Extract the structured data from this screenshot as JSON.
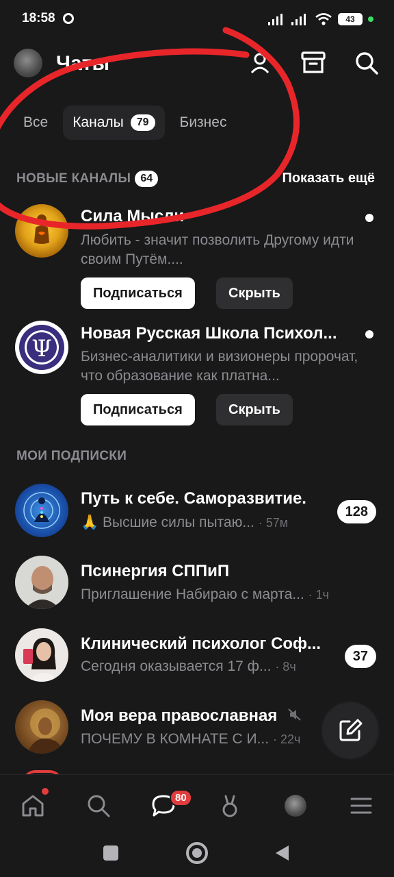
{
  "status_bar": {
    "time": "18:58",
    "battery": "43"
  },
  "header": {
    "title": "Чаты"
  },
  "tabs": [
    {
      "label": "Все"
    },
    {
      "label": "Каналы",
      "badge": "79"
    },
    {
      "label": "Бизнес"
    }
  ],
  "new_channels": {
    "title": "НОВЫЕ КАНАЛЫ",
    "badge": "64",
    "show_more": "Показать ещё",
    "items": [
      {
        "title": "Сила Мысли",
        "description": "Любить - значит позволить Другому идти своим Путём....",
        "subscribe": "Подписаться",
        "hide": "Скрыть"
      },
      {
        "title": "Новая Русская Школа Психол...",
        "description": "Бизнес-аналитики и визионеры пророчат, что образование как платна...",
        "subscribe": "Подписаться",
        "hide": "Скрыть"
      }
    ]
  },
  "subscriptions": {
    "title": "МОИ ПОДПИСКИ",
    "items": [
      {
        "title": "Путь к себе. Саморазвитие.",
        "preview": "🙏 Высшие силы пытаю...",
        "time": "· 57м",
        "count": "128"
      },
      {
        "title": "Псинергия СППиП",
        "preview": "Приглашение  Набираю с марта...",
        "time": "· 1ч",
        "count": ""
      },
      {
        "title": "Клинический психолог Соф...",
        "preview": "Сегодня оказывается 17 ф...",
        "time": "· 8ч",
        "count": "37"
      },
      {
        "title": "Моя вера православная",
        "preview": "ПОЧЕМУ В КОМНАТЕ С И...",
        "time": "· 22ч",
        "count": ""
      }
    ]
  },
  "bottom_nav": {
    "messages_badge": "80",
    "icons": [
      "home-icon",
      "search-icon",
      "messages-icon",
      "clips-icon",
      "profile-avatar",
      "menu-icon"
    ]
  },
  "colors": {
    "background": "#19191a",
    "annotation": "#e8262a",
    "badge_red": "#e23c3c"
  }
}
